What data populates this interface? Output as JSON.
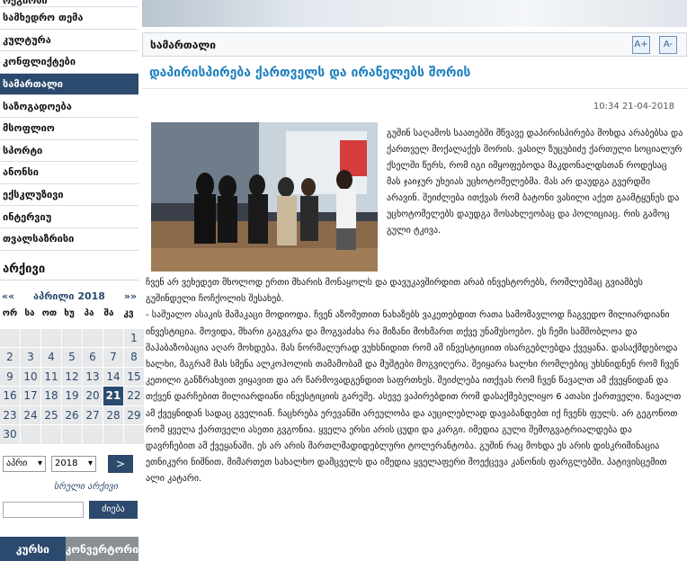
{
  "sidebar": {
    "items": [
      {
        "label": "რეგიონი",
        "active": false
      },
      {
        "label": "სამხედრო თემა",
        "active": false
      },
      {
        "label": "კულტურა",
        "active": false
      },
      {
        "label": "კონფლიქტები",
        "active": false
      },
      {
        "label": "სამართალი",
        "active": true
      },
      {
        "label": "საზოგადოება",
        "active": false
      },
      {
        "label": "მსოფლიო",
        "active": false
      },
      {
        "label": "სპორტი",
        "active": false
      },
      {
        "label": "ანონსი",
        "active": false
      },
      {
        "label": "ექსკლუზივი",
        "active": false
      },
      {
        "label": "ინტერვიუ",
        "active": false
      },
      {
        "label": "თვალსაზრისი",
        "active": false
      }
    ]
  },
  "archive": {
    "title": "არქივი",
    "prev": "««",
    "next": "»»",
    "month_label": "აპრილი 2018",
    "weekdays": [
      "ორ",
      "სა",
      "ოთ",
      "ხუ",
      "პა",
      "შა",
      "კვ"
    ],
    "weeks": [
      [
        "",
        "",
        "",
        "",
        "",
        "",
        "1"
      ],
      [
        "2",
        "3",
        "4",
        "5",
        "6",
        "7",
        "8"
      ],
      [
        "9",
        "10",
        "11",
        "12",
        "13",
        "14",
        "15"
      ],
      [
        "16",
        "17",
        "18",
        "19",
        "20",
        "21",
        "22"
      ],
      [
        "23",
        "24",
        "25",
        "26",
        "27",
        "28",
        "29"
      ],
      [
        "30",
        "",
        "",
        "",
        "",
        "",
        ""
      ]
    ],
    "today": "21",
    "month_select": "აპრი",
    "year_select": "2018",
    "go_label": ">",
    "full_archive_label": "სრული არქივი",
    "search_button": "ძიება"
  },
  "bottom_tabs": {
    "left": "კურსი",
    "right": "კონვერტორი"
  },
  "section": {
    "title": "სამართალი",
    "font_up": "A+",
    "font_down": "A-"
  },
  "article": {
    "title": "დაპირისპირება ქართველს და ირანელებს შორის",
    "datetime": "10:34 21-04-2018",
    "intro": "გუშინ საღამოს საათებში მწვავე დაპირისპირება მოხდა არაბებსა და ქართველ მოქალაქეს შორის. ვასილ ზუცუბიძე ქართული სოციალურ ქსელში წერს, რომ იგი იმყოფებოდა მაკდონალდსთან როდესაც მას ჯაიჯურ უხეიას უცხოტომელებმა. მას არ დაუდგა გვერდში არავინ. შეიძლება ითქვას რომ ბატონი ვასილი აქეთ გაამტყუნეს და უცხოტომელებს დაუდგა მოსახლეობაც და პოლიციაც. რის გამოც გული ტკივა.",
    "body": "ჩვენ არ ვეხედეთ მხოლოდ ერთი მხარის მონაყოლს და დავუკავშირდით არაბ ინვესტორებს, რომლებმაც გვიამბეს გუშინდელი ჩოჩქოლის შესახებ.\n- საშუალო ასაკის მამაკაცი მოდიოდა. ჩვენ აზომეთით ნახაზებს ვაკეთებდით რათა სამომავლოდ ჩაგვედო მილიარდიანი ინვესტიცია. მოვიდა, მხარი გაგვკრა და მოგვაძახა რა მიზანი მოხმართ თქვე უნამუსოებო. ეს ჩემი სამშობლოა და შაჰაბაზობაცია აღარ მოხდება. მას ნორმალურად ვუხსნიდით რომ ამ ინვესტიციით ისარგებლებდა ქვეყანა. დასაქმდებოდა ხალხი, მაგრამ მას სმენა ალკოჰოლის თამამობამ და მუშტები მოგვიღერა. შეიყარა ხალხი რომლებიც უხსნიდნენ რომ ჩვენ კეთილი განზრახვით ვიყავით და არ წარმოვადგენდით საფრთხეს. შეიძლება ითქვას რომ ჩვენ წავალთ ამ ქვეყნიდან და თქვენ დარჩებით მილიარდიანი ინვესტიციის გარეშე. ასევე ვაპირებდით რომ დასაქმებულიყო 6 ათასი ქართველი. წავალთ ამ ქვეყნიდან სადაც გველიან. ჩაცხრება ერევანში არეულობა და აუცილებლად დავაბანდებთ იქ ჩვენს ფულს. არ გეგონოთ რომ ყველა ქართველი ასეთი გვგონია. ყველა ერსი არის ცუდი და კარგი. იმედია გული შემოგვატრიალდება და დავრჩებით ამ ქვეყანაში. ეს არ არის მართლმადიდებლური ტოლერანტობა. გუშინ რაც მოხდა ეს არის დისკრიმინაცია ეთნიკური ნიშნით. მიმართეთ სახალხო დამცველს და იმედია ყველაფერი მოექცევა კანონის ფარგლებში. პატივისცემით ალი კატარი."
  },
  "colors": {
    "navy": "#2c4a6e",
    "title_blue": "#1f7fbf",
    "calendar_cell": "#e6e8ea"
  }
}
